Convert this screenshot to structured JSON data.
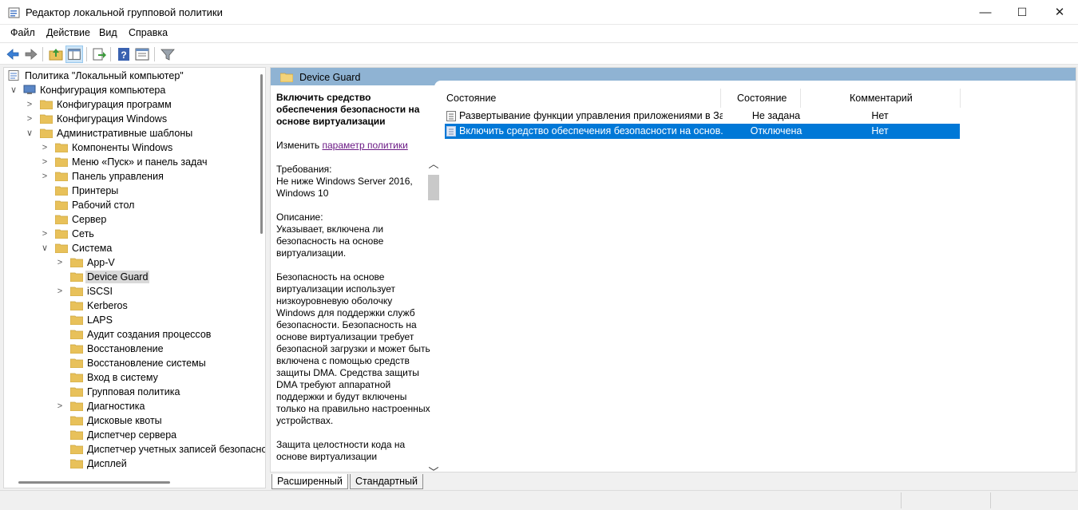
{
  "window": {
    "title": "Редактор локальной групповой политики",
    "minimize_glyph": "—",
    "maximize_glyph": "☐",
    "close_glyph": "✕"
  },
  "menu": [
    "Файл",
    "Действие",
    "Вид",
    "Справка"
  ],
  "toolbar": {
    "icons": [
      "back-arrow-icon",
      "forward-arrow-icon",
      "up-folder-icon",
      "show-hide-tree-icon",
      "export-list-icon",
      "help-icon",
      "properties-icon",
      "filter-icon"
    ]
  },
  "tree": {
    "items": [
      {
        "label": "Политика \"Локальный компьютер\"",
        "depth": 0,
        "chevron": "",
        "icon": "policy-icon"
      },
      {
        "label": "Конфигурация компьютера",
        "depth": 0,
        "chevron": "∨",
        "icon": "computer-icon"
      },
      {
        "label": "Конфигурация программ",
        "depth": 1,
        "chevron": ">",
        "icon": "folder-icon"
      },
      {
        "label": "Конфигурация Windows",
        "depth": 1,
        "chevron": ">",
        "icon": "folder-icon"
      },
      {
        "label": "Административные шаблоны",
        "depth": 1,
        "chevron": "∨",
        "icon": "folder-icon"
      },
      {
        "label": "Компоненты Windows",
        "depth": 2,
        "chevron": ">",
        "icon": "folder-icon"
      },
      {
        "label": "Меню «Пуск» и панель задач",
        "depth": 2,
        "chevron": ">",
        "icon": "folder-icon"
      },
      {
        "label": "Панель управления",
        "depth": 2,
        "chevron": ">",
        "icon": "folder-icon"
      },
      {
        "label": "Принтеры",
        "depth": 2,
        "chevron": "",
        "icon": "folder-icon"
      },
      {
        "label": "Рабочий стол",
        "depth": 2,
        "chevron": "",
        "icon": "folder-icon"
      },
      {
        "label": "Сервер",
        "depth": 2,
        "chevron": "",
        "icon": "folder-icon"
      },
      {
        "label": "Сеть",
        "depth": 2,
        "chevron": ">",
        "icon": "folder-icon"
      },
      {
        "label": "Система",
        "depth": 2,
        "chevron": "∨",
        "icon": "folder-icon"
      },
      {
        "label": "App-V",
        "depth": 3,
        "chevron": ">",
        "icon": "folder-icon"
      },
      {
        "label": "Device Guard",
        "depth": 3,
        "chevron": "",
        "icon": "folder-icon",
        "selected": true
      },
      {
        "label": "iSCSI",
        "depth": 3,
        "chevron": ">",
        "icon": "folder-icon"
      },
      {
        "label": "Kerberos",
        "depth": 3,
        "chevron": "",
        "icon": "folder-icon"
      },
      {
        "label": "LAPS",
        "depth": 3,
        "chevron": "",
        "icon": "folder-icon"
      },
      {
        "label": "Аудит создания процессов",
        "depth": 3,
        "chevron": "",
        "icon": "folder-icon"
      },
      {
        "label": "Восстановление",
        "depth": 3,
        "chevron": "",
        "icon": "folder-icon"
      },
      {
        "label": "Восстановление системы",
        "depth": 3,
        "chevron": "",
        "icon": "folder-icon"
      },
      {
        "label": "Вход в систему",
        "depth": 3,
        "chevron": "",
        "icon": "folder-icon"
      },
      {
        "label": "Групповая политика",
        "depth": 3,
        "chevron": "",
        "icon": "folder-icon"
      },
      {
        "label": "Диагностика",
        "depth": 3,
        "chevron": ">",
        "icon": "folder-icon"
      },
      {
        "label": "Дисковые квоты",
        "depth": 3,
        "chevron": "",
        "icon": "folder-icon"
      },
      {
        "label": "Диспетчер сервера",
        "depth": 3,
        "chevron": "",
        "icon": "folder-icon"
      },
      {
        "label": "Диспетчер учетных записей безопасности",
        "depth": 3,
        "chevron": "",
        "icon": "folder-icon"
      },
      {
        "label": "Дисплей",
        "depth": 3,
        "chevron": "",
        "icon": "folder-icon"
      }
    ]
  },
  "right_header": {
    "title": "Device Guard"
  },
  "description": {
    "title": "Включить средство обеспечения безопасности на основе виртуализации",
    "edit_prefix": "Изменить ",
    "edit_link": "параметр политики",
    "requirements_label": "Требования:",
    "requirements": "Не ниже Windows Server 2016, Windows 10",
    "description_label": "Описание:",
    "description": "Указывает, включена ли безопасность на основе виртуализации.",
    "para2": "Безопасность на основе виртуализации использует низкоуровневую оболочку Windows для поддержки служб безопасности. Безопасность на основе виртуализации требует безопасной загрузки и может быть включена с помощью средств защиты DMA. Средства защиты DMA требуют аппаратной поддержки и будут включены только на правильно настроенных устройствах.",
    "para3": "Защита целостности кода на основе виртуализации"
  },
  "list": {
    "columns": [
      "Состояние",
      "Состояние",
      "Комментарий"
    ],
    "rows": [
      {
        "name": "Развертывание функции управления приложениями в За...",
        "state": "Не задана",
        "comment": "Нет",
        "selected": false
      },
      {
        "name": "Включить средство обеспечения безопасности на основ...",
        "state": "Отключена",
        "comment": "Нет",
        "selected": true
      }
    ]
  },
  "tabs": [
    "Расширенный",
    "Стандартный"
  ],
  "colors": {
    "selection": "#0078d7",
    "header_band": "#8fb3d3",
    "link": "#6b1a85",
    "folder": "#e8c15a"
  }
}
